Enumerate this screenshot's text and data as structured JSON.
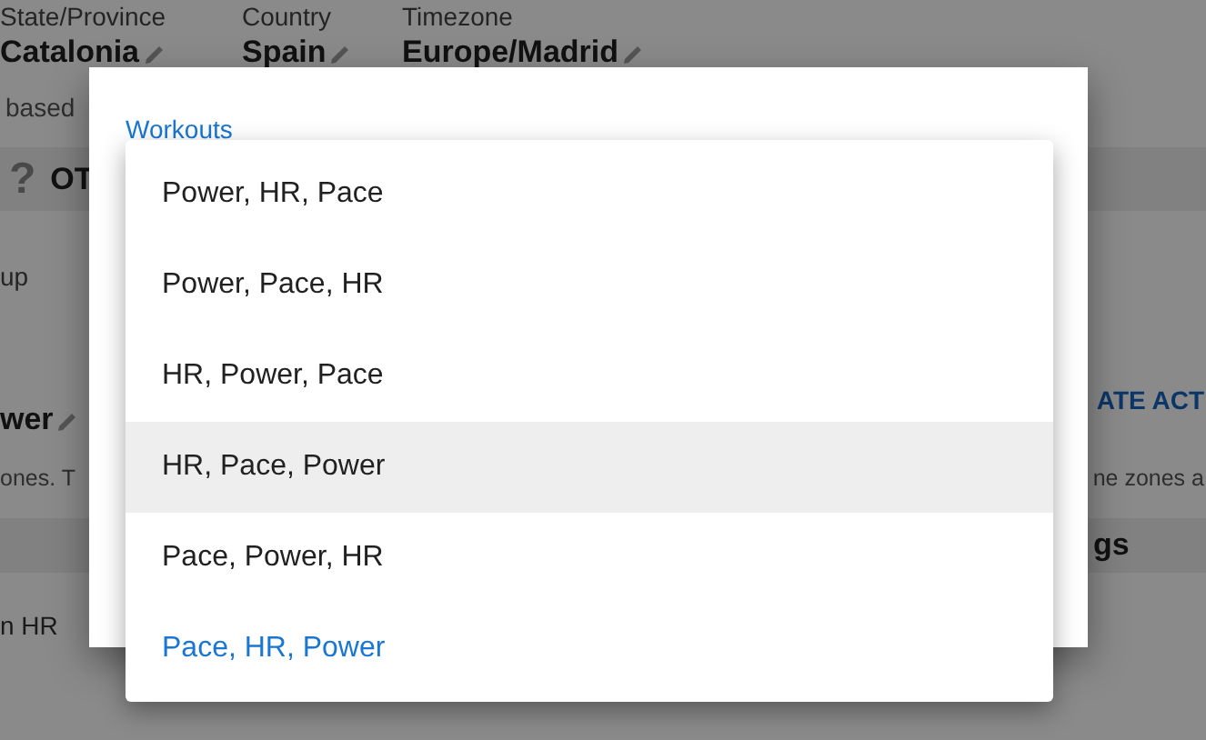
{
  "page": {
    "fields": [
      {
        "label": "State/Province",
        "value": "Catalonia"
      },
      {
        "label": "Country",
        "value": "Spain"
      },
      {
        "label": "Timezone",
        "value": "Europe/Madrid"
      }
    ],
    "note": "based",
    "section": {
      "glyph": "?",
      "title": "OT"
    },
    "row_label": "up",
    "setting_value": "wer",
    "action_link": "ATE ACT",
    "setting_note_left": "ones. T",
    "setting_note_right": "ne zones a",
    "table_header": "gs",
    "table_row_label": "n HR"
  },
  "dialog": {
    "field_label": "Workouts",
    "options": [
      {
        "label": "Power, HR, Pace",
        "selected": false,
        "highlighted": false
      },
      {
        "label": "Power, Pace, HR",
        "selected": false,
        "highlighted": false
      },
      {
        "label": "HR, Power, Pace",
        "selected": false,
        "highlighted": false
      },
      {
        "label": "HR, Pace, Power",
        "selected": false,
        "highlighted": true
      },
      {
        "label": "Pace, Power, HR",
        "selected": false,
        "highlighted": false
      },
      {
        "label": "Pace, HR, Power",
        "selected": true,
        "highlighted": false
      }
    ]
  }
}
